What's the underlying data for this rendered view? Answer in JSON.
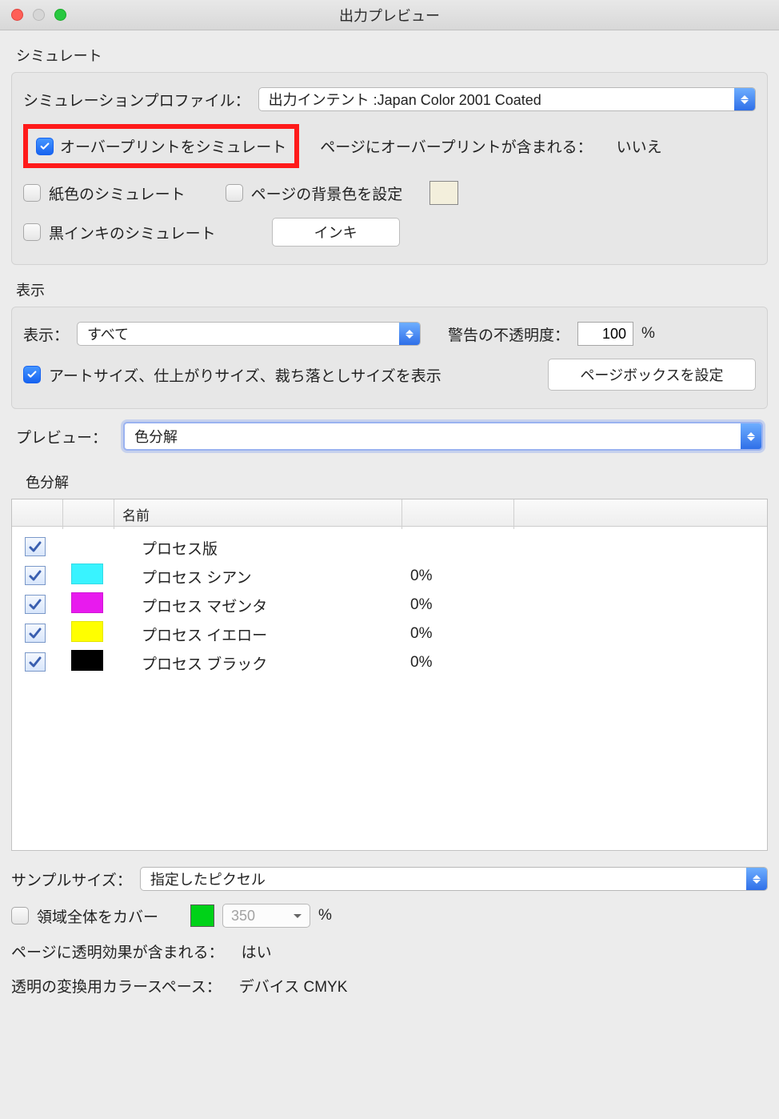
{
  "window": {
    "title": "出力プレビュー"
  },
  "simulate": {
    "title": "シミュレート",
    "profile_label": "シミュレーションプロファイル：",
    "profile_value": "出力インテント :Japan Color 2001 Coated",
    "overprint_label": "オーバープリントをシミュレート",
    "overprint_checked": true,
    "page_contains_overprint_label": "ページにオーバープリントが含まれる：",
    "page_contains_overprint_value": "いいえ",
    "paper_color_label": "紙色のシミュレート",
    "paper_color_checked": false,
    "set_bg_label": "ページの背景色を設定",
    "set_bg_checked": false,
    "bg_color": "#f3efdc",
    "black_ink_label": "黒インキのシミュレート",
    "black_ink_checked": false,
    "ink_button": "インキ"
  },
  "display": {
    "title": "表示",
    "show_label": "表示：",
    "show_value": "すべて",
    "opacity_label": "警告の不透明度：",
    "opacity_value": "100",
    "opacity_unit": "%",
    "artsize_label": "アートサイズ、仕上がりサイズ、裁ち落としサイズを表示",
    "artsize_checked": true,
    "pagebox_button": "ページボックスを設定"
  },
  "preview": {
    "label": "プレビュー：",
    "value": "色分解"
  },
  "separations": {
    "title": "色分解",
    "header_name": "名前",
    "rows": [
      {
        "name": "プロセス版",
        "swatch": "",
        "percent": ""
      },
      {
        "name": "プロセス シアン",
        "swatch": "cyan",
        "percent": "0%"
      },
      {
        "name": "プロセス マゼンタ",
        "swatch": "magenta",
        "percent": "0%"
      },
      {
        "name": "プロセス イエロー",
        "swatch": "yellow",
        "percent": "0%"
      },
      {
        "name": "プロセス ブラック",
        "swatch": "black",
        "percent": "0%"
      }
    ]
  },
  "footer": {
    "sample_size_label": "サンプルサイズ：",
    "sample_size_value": "指定したピクセル",
    "cover_all_label": "領域全体をカバー",
    "cover_all_checked": false,
    "cover_color": "#00d218",
    "cover_value": "350",
    "cover_unit": "%",
    "transparency_label": "ページに透明効果が含まれる：",
    "transparency_value": "はい",
    "colorspace_label": "透明の変換用カラースペース：",
    "colorspace_value": "デバイス CMYK"
  }
}
